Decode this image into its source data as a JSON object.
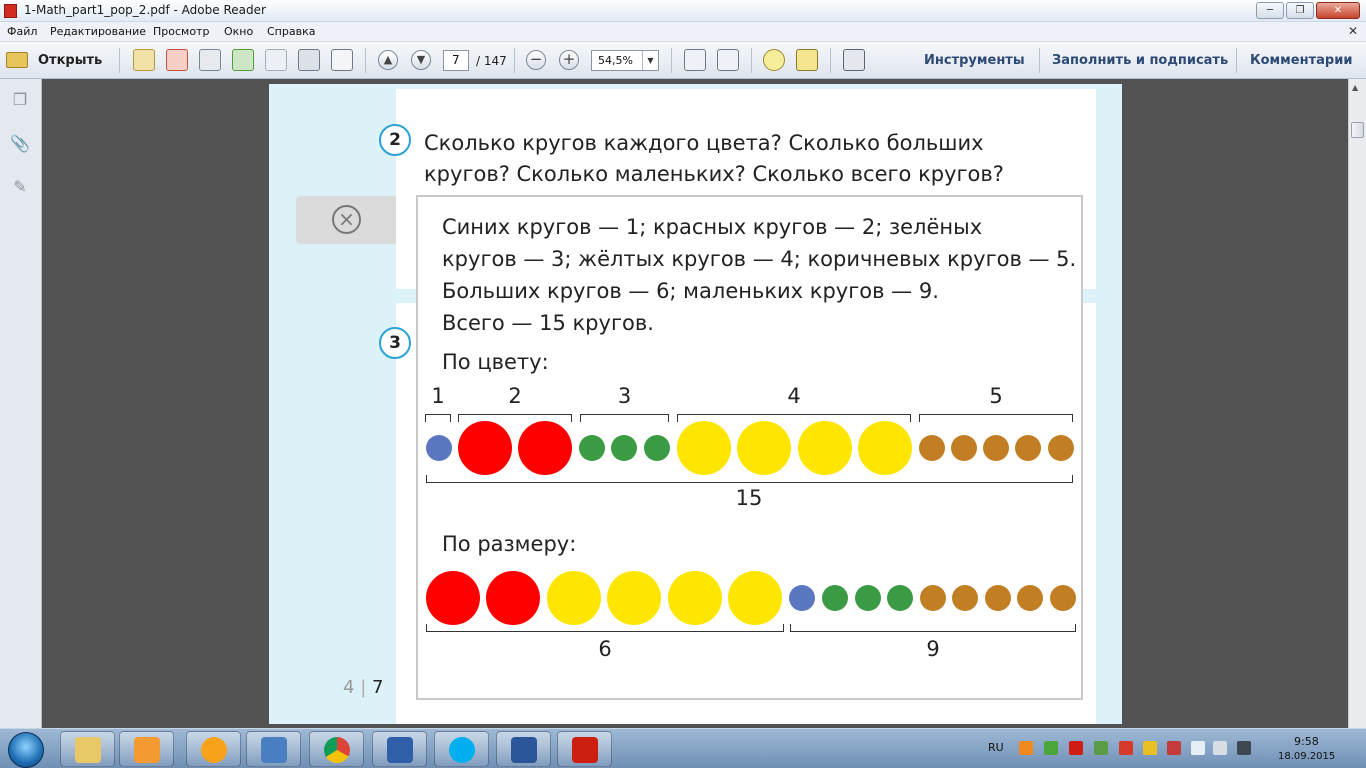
{
  "window": {
    "title": "1-Math_part1_pop_2.pdf - Adobe Reader"
  },
  "menu": {
    "items": [
      "Файл",
      "Редактирование",
      "Просмотр",
      "Окно",
      "Справка"
    ]
  },
  "toolbar": {
    "open_label": "Открыть",
    "page_current": "7",
    "page_total": "/ 147",
    "zoom": "54,5%",
    "tools_label": "Инструменты",
    "fill_sign_label": "Заполнить и подписать",
    "comments_label": "Комментарии"
  },
  "document": {
    "task2_number": "2",
    "task3_number": "3",
    "question": "Сколько кругов каждого цвета? Сколько больших кругов? Сколько маленьких? Сколько всего кругов?",
    "answer": {
      "text_lines": [
        "Синих кругов — 1; красных кругов — 2; зелёных",
        "кругов — 3; жёлтых кругов — 4; коричневых кругов — 5.",
        "Больших кругов — 6; маленьких кругов — 9.",
        "Всего — 15 кругов."
      ],
      "by_color_label": "По цвету:",
      "by_color_groups": [
        "1",
        "2",
        "3",
        "4",
        "5"
      ],
      "by_color_total": "15",
      "by_size_label": "По размеру:",
      "by_size_groups": [
        "6",
        "9"
      ]
    },
    "page_number_left": "4",
    "page_number_sep": "|",
    "page_number_right": "7"
  },
  "colors": {
    "blue": "#5b77c0",
    "red": "#ff0000",
    "green": "#3b9b45",
    "yellow": "#ffe600",
    "brown": "#c17e23",
    "badge_border": "#2aa2d6",
    "light_blue_bg": "#ddf1f9"
  },
  "taskbar": {
    "apps": [
      "explorer",
      "media-player",
      "messenger",
      "volume-app",
      "chrome",
      "k-app",
      "skype",
      "word",
      "adobe-reader"
    ],
    "language": "RU",
    "time": "9:58",
    "date": "18.09.2015"
  }
}
